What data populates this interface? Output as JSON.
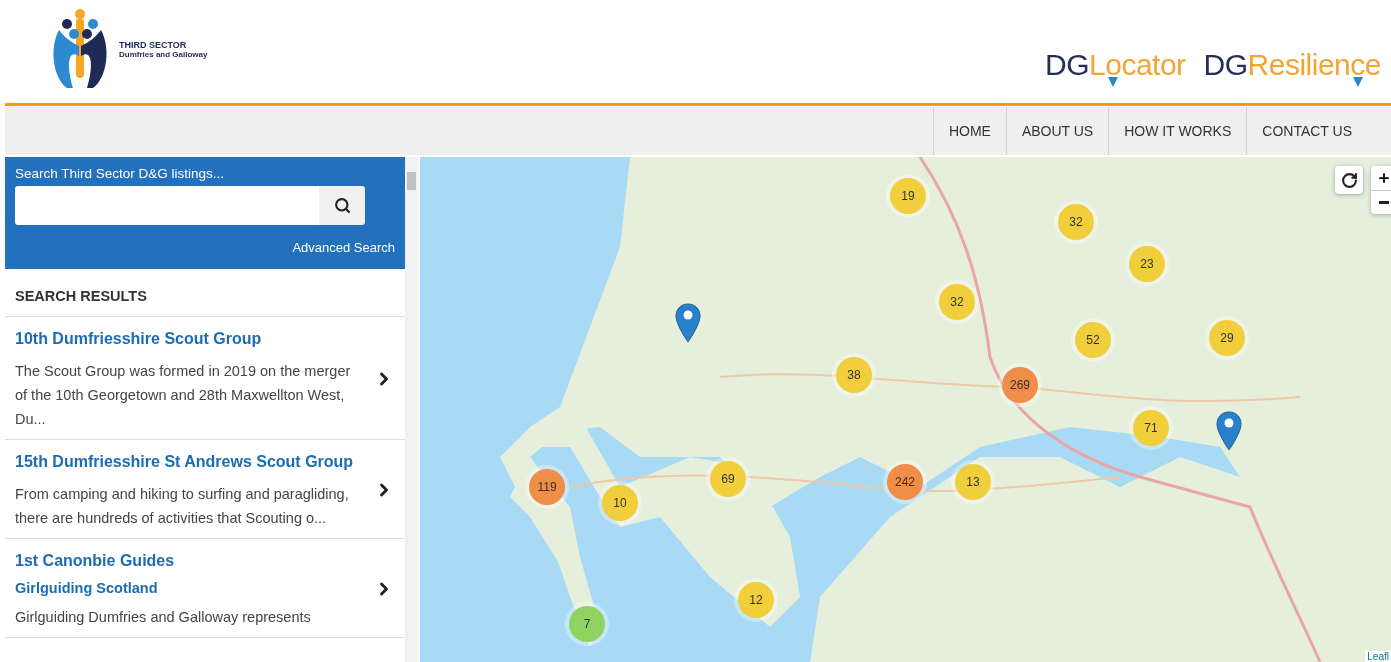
{
  "header": {
    "org_logo": {
      "title": "THIRD SECTOR",
      "subtitle": "Dumfries and Galloway"
    },
    "brands": [
      {
        "prefix": "DG",
        "suffix": "Locator"
      },
      {
        "prefix": "DG",
        "suffix": "Resilience"
      }
    ]
  },
  "nav": {
    "items": [
      {
        "label": "HOME"
      },
      {
        "label": "ABOUT US"
      },
      {
        "label": "HOW IT WORKS"
      },
      {
        "label": "CONTACT US"
      }
    ]
  },
  "search": {
    "label": "Search Third Sector D&G listings...",
    "advanced_link": "Advanced Search"
  },
  "results": {
    "heading": "SEARCH RESULTS",
    "items": [
      {
        "title": "10th Dumfriesshire Scout Group",
        "description": "The Scout Group was formed in 2019 on the merger of the 10th Georgetown and 28th Maxwellton West, Du..."
      },
      {
        "title": "15th Dumfriesshire St Andrews Scout Group",
        "description": "From camping and hiking to surfing and paragliding, there are hundreds of activities that Scouting o..."
      },
      {
        "title": "1st Canonbie Guides",
        "subtitle": "Girlguiding Scotland",
        "description": "Girlguiding Dumfries and Galloway represents"
      }
    ]
  },
  "map": {
    "clusters": [
      {
        "count": "19",
        "color": "#f1cf3c"
      },
      {
        "count": "32",
        "color": "#f1cf3c"
      },
      {
        "count": "23",
        "color": "#f1cf3c"
      },
      {
        "count": "32",
        "color": "#f1cf3c"
      },
      {
        "count": "52",
        "color": "#f1cf3c"
      },
      {
        "count": "29",
        "color": "#f1cf3c"
      },
      {
        "count": "38",
        "color": "#f1cf3c"
      },
      {
        "count": "269",
        "color": "#f08d49"
      },
      {
        "count": "71",
        "color": "#f1cf3c"
      },
      {
        "count": "119",
        "color": "#f08d49"
      },
      {
        "count": "69",
        "color": "#f1cf3c"
      },
      {
        "count": "242",
        "color": "#f08d49"
      },
      {
        "count": "13",
        "color": "#f1cf3c"
      },
      {
        "count": "10",
        "color": "#f1cf3c"
      },
      {
        "count": "12",
        "color": "#f1cf3c"
      },
      {
        "count": "7",
        "color": "#8fd460"
      }
    ],
    "attribution": "Leafl"
  }
}
